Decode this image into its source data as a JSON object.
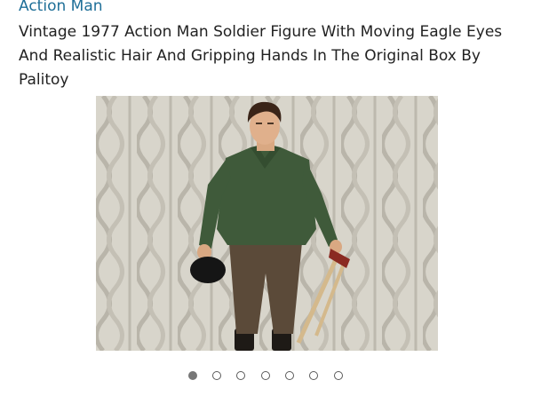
{
  "brand": {
    "label": "Action Man"
  },
  "product": {
    "title": "Vintage 1977 Action Man Soldier Figure With Moving Eagle Eyes And Realistic Hair And Gripping Hands In The Original Box By Palitoy"
  },
  "gallery": {
    "total_images": 7,
    "active_index": 0
  },
  "colors": {
    "brand_link": "#1f6f98",
    "title_text": "#222222",
    "dot_active": "#777777",
    "dot_inactive_border": "#5a5a5a"
  }
}
